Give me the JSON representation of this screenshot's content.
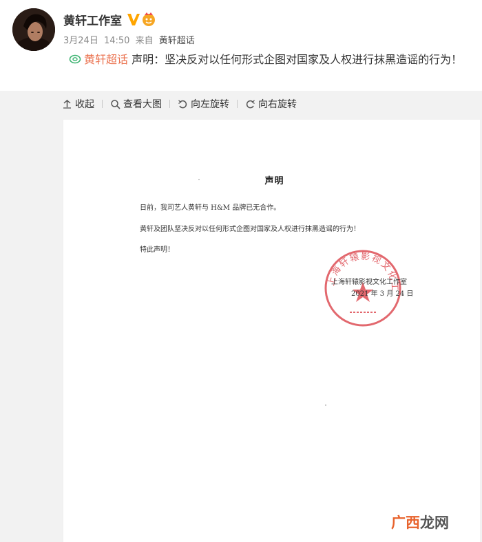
{
  "post": {
    "author": "黄轩工作室",
    "date": "3月24日",
    "time": "14:50",
    "from_label": "来自",
    "source": "黄轩超话",
    "topic": "黄轩超话",
    "text": "声明：坚决反对以任何形式企图对国家及人权进行抹黑造谣的行为！"
  },
  "toolbar": {
    "collapse": "收起",
    "view_large": "查看大图",
    "rotate_left": "向左旋转",
    "rotate_right": "向右旋转"
  },
  "document": {
    "title": "声明",
    "line1": "日前，我司艺人黄轩与 H&M 品牌已无合作。",
    "line2": "黄轩及团队坚决反对以任何形式企图对国家及人权进行抹黑造谣的行为！",
    "line3": "特此声明！",
    "signature": "上海轩辕影视文化工作室",
    "date": "2021 年 3 月 24 日",
    "seal_text": "上海轩辕影视文化工作室"
  },
  "watermark": {
    "part1": "广西",
    "part2": "龙网"
  },
  "colors": {
    "topic": "#eb7350",
    "verified": "#ffa500",
    "seal": "#d9363e"
  },
  "icons": {
    "verified": "verified-v-icon",
    "vip": "vip-badge-icon",
    "topic": "supertopic-icon",
    "collapse": "collapse-arrow-icon",
    "view_large": "zoom-icon",
    "rotate_left": "rotate-left-icon",
    "rotate_right": "rotate-right-icon"
  }
}
